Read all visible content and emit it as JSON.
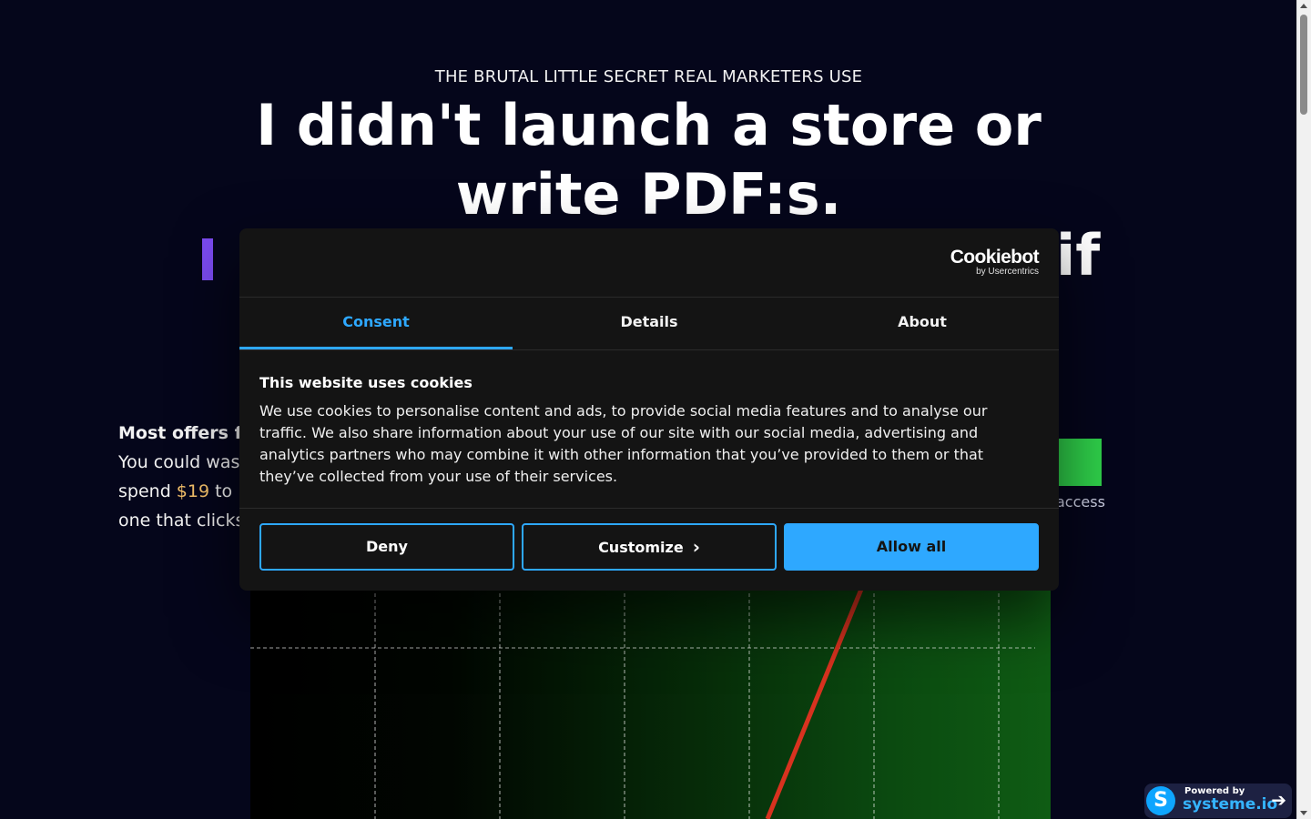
{
  "hero": {
    "eyebrow": "THE BRUTAL LITTLE SECRET REAL MARKETERS USE",
    "headline_line1": "I didn't launch a store or",
    "headline_line2": "write PDF:s.",
    "subline_right_fragment": "if"
  },
  "left_copy": {
    "line1": "Most offers f",
    "line2": "You could was",
    "line3_pre": "spend ",
    "line3_price": "$19",
    "line3_post": " to",
    "line4": "one that clicks"
  },
  "cta": {
    "access_fragment": "access",
    "button_color": "#2fd04a"
  },
  "cookie_dialog": {
    "brand_name": "Cookiebot",
    "brand_by": "by Usercentrics",
    "tabs": [
      {
        "label": "Consent",
        "active": true
      },
      {
        "label": "Details",
        "active": false
      },
      {
        "label": "About",
        "active": false
      }
    ],
    "title": "This website uses cookies",
    "body": "We use cookies to personalise content and ads, to provide social media features and to analyse our traffic. We also share information about your use of our site with our social media, advertising and analytics partners who may combine it with other information that you’ve provided to them or that they’ve collected from your use of their services.",
    "buttons": {
      "deny": "Deny",
      "customize": "Customize",
      "allow_all": "Allow all"
    },
    "accent_color": "#2ea8ff"
  },
  "badge": {
    "logo_letter": "S",
    "powered_by": "Powered by",
    "brand": "systeme.io"
  },
  "icons": {
    "chevron": "chevron-right-icon",
    "arrow": "arrow-right-icon"
  }
}
